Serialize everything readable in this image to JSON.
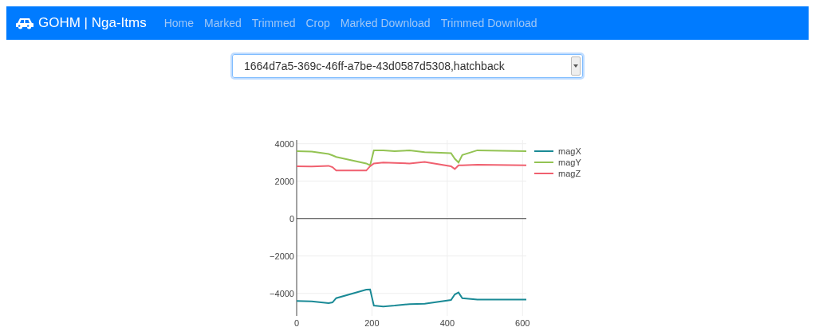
{
  "navbar": {
    "brand": "GOHM | Nga-Itms",
    "links": [
      {
        "label": "Home"
      },
      {
        "label": "Marked"
      },
      {
        "label": "Trimmed"
      },
      {
        "label": "Crop"
      },
      {
        "label": "Marked Download"
      },
      {
        "label": "Trimmed Download"
      }
    ]
  },
  "select": {
    "value": "1664d7a5-369c-46ff-a7be-43d0587d5308,hatchback"
  },
  "chart": {
    "chart_data": {
      "type": "line",
      "x": [
        0,
        40,
        85,
        95,
        105,
        185,
        195,
        205,
        230,
        260,
        300,
        340,
        410,
        420,
        430,
        440,
        480,
        610
      ],
      "series": [
        {
          "name": "magX",
          "color": "#1a8a96",
          "values": [
            -4400,
            -4420,
            -4520,
            -4480,
            -4250,
            -3800,
            -3790,
            -4650,
            -4700,
            -4650,
            -4570,
            -4550,
            -4350,
            -4050,
            -3950,
            -4250,
            -4330,
            -4330
          ]
        },
        {
          "name": "magY",
          "color": "#93c353",
          "values": [
            3600,
            3580,
            3450,
            3380,
            3300,
            2950,
            2850,
            3650,
            3650,
            3600,
            3650,
            3550,
            3500,
            3200,
            3000,
            3400,
            3650,
            3600
          ]
        },
        {
          "name": "magZ",
          "color": "#f0606f",
          "values": [
            2800,
            2790,
            2820,
            2750,
            2570,
            2570,
            2800,
            2950,
            3000,
            2980,
            2950,
            3030,
            2800,
            2650,
            2850,
            2850,
            2880,
            2850
          ]
        }
      ],
      "grid": true,
      "legend": true,
      "xlim": [
        0,
        610
      ],
      "ylim": [
        -5200,
        4200
      ],
      "xticks": [
        0,
        200,
        400,
        600
      ],
      "yticks": [
        {
          "value": -4000,
          "label": "−4000"
        },
        {
          "value": -2000,
          "label": "−2000"
        },
        0,
        2000,
        4000
      ]
    }
  }
}
